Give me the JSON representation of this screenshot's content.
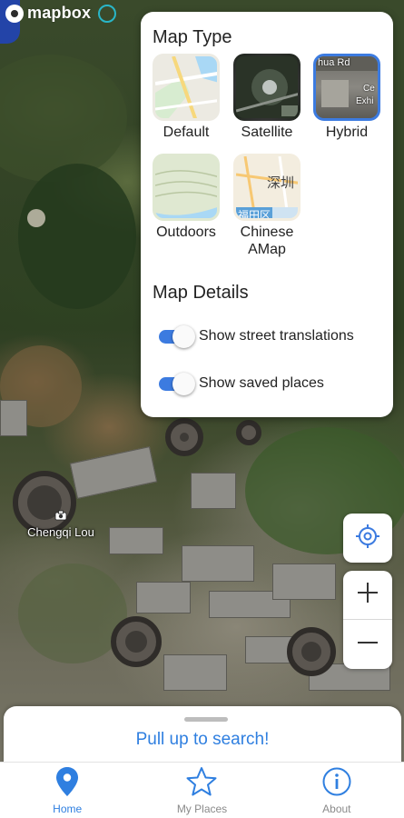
{
  "app": {
    "logo_text": "mapbox"
  },
  "colors": {
    "accent": "#3c7be0",
    "link": "#2f7fe0",
    "inactive": "#8a8a8a"
  },
  "map_type_panel": {
    "title": "Map Type",
    "types": [
      {
        "label": "Default",
        "selected": false
      },
      {
        "label": "Satellite",
        "selected": false
      },
      {
        "label": "Hybrid",
        "selected": true,
        "thumb_texts": [
          "hua Rd",
          "Ce",
          "Exhi"
        ]
      },
      {
        "label": "Outdoors",
        "selected": false
      },
      {
        "label": "Chinese\nAMap",
        "selected": false,
        "thumb_texts": [
          "深圳",
          "福田区"
        ]
      }
    ],
    "details_title": "Map Details",
    "toggles": [
      {
        "label": "Show street translations",
        "on": true
      },
      {
        "label": "Show saved places",
        "on": true
      }
    ]
  },
  "map": {
    "poi_label": "Chengqi Lou",
    "poi_icon": "camera-icon"
  },
  "controls": {
    "locate_icon": "locate-icon",
    "zoom_in_symbol": "+",
    "zoom_out_symbol": "−"
  },
  "bottom_sheet": {
    "cta": "Pull up to search!"
  },
  "nav": [
    {
      "label": "Home",
      "icon": "map-pin-icon",
      "active": true
    },
    {
      "label": "My Places",
      "icon": "star-icon",
      "active": false
    },
    {
      "label": "About",
      "icon": "info-icon",
      "active": false
    }
  ]
}
